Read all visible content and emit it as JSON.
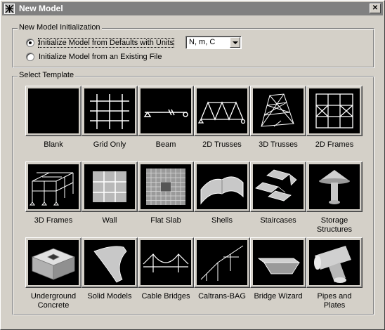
{
  "window": {
    "title": "New Model",
    "close_icon": "close-icon"
  },
  "init_group": {
    "label": "New Model Initialization",
    "option_defaults": "Initialize Model from Defaults with Units",
    "option_existing": "Initialize Model  from an Existing File",
    "units_value": "N, m, C"
  },
  "template_group": {
    "label": "Select Template",
    "tiles": [
      {
        "label": "Blank",
        "icon": "blank-icon"
      },
      {
        "label": "Grid Only",
        "icon": "grid-only-icon"
      },
      {
        "label": "Beam",
        "icon": "beam-icon"
      },
      {
        "label": "2D Trusses",
        "icon": "2d-trusses-icon"
      },
      {
        "label": "3D Trusses",
        "icon": "3d-trusses-icon"
      },
      {
        "label": "2D Frames",
        "icon": "2d-frames-icon"
      },
      {
        "label": "3D Frames",
        "icon": "3d-frames-icon"
      },
      {
        "label": "Wall",
        "icon": "wall-icon"
      },
      {
        "label": "Flat Slab",
        "icon": "flat-slab-icon"
      },
      {
        "label": "Shells",
        "icon": "shells-icon"
      },
      {
        "label": "Staircases",
        "icon": "staircases-icon"
      },
      {
        "label": "Storage\nStructures",
        "icon": "storage-structures-icon"
      },
      {
        "label": "Underground\nConcrete",
        "icon": "underground-concrete-icon"
      },
      {
        "label": "Solid Models",
        "icon": "solid-models-icon"
      },
      {
        "label": "Cable Bridges",
        "icon": "cable-bridges-icon"
      },
      {
        "label": "Caltrans-BAG",
        "icon": "caltrans-bag-icon"
      },
      {
        "label": "Bridge Wizard",
        "icon": "bridge-wizard-icon"
      },
      {
        "label": "Pipes and\nPlates",
        "icon": "pipes-and-plates-icon"
      }
    ]
  }
}
